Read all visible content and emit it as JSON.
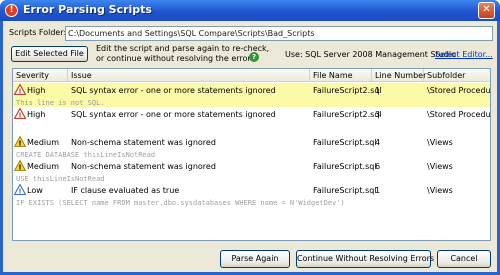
{
  "window": {
    "title": "Error Parsing Scripts",
    "close_glyph": "✕"
  },
  "folder": {
    "label": "Scripts Folder:",
    "value": "C:\\Documents and Settings\\SQL Compare\\Scripts\\Bad_Scripts"
  },
  "toolbar": {
    "edit_button": "Edit Selected File",
    "hint_line1": "Edit the script and parse again to re-check,",
    "hint_line2": "or continue without resolving the errors",
    "use_text": "Use: SQL Server 2008 Management Studio",
    "select_editor": "Select Editor..."
  },
  "columns": [
    "Severity",
    "Issue",
    "File Name",
    "Line Number",
    "Subfolder"
  ],
  "rows": [
    {
      "severity": "High",
      "icon": "error-icon",
      "issue": "SQL syntax error - one or more statements ignored",
      "file": "FailureScript2.sql",
      "line": "1",
      "subfolder": "\\Stored Procedures",
      "code": "This line is not SQL.",
      "selected": true
    },
    {
      "severity": "High",
      "icon": "error-icon",
      "issue": "SQL syntax error - one or more statements ignored",
      "file": "FailureScript2.sql",
      "line": "3",
      "subfolder": "\\Stored Procedures",
      "code": ""
    },
    {
      "severity": "Medium",
      "icon": "warning-icon",
      "issue": "Non-schema statement was ignored",
      "file": "FailureScript.sql",
      "line": "4",
      "subfolder": "\\Views",
      "code": "CREATE DATABASE thisLineIsNotRead"
    },
    {
      "severity": "Medium",
      "icon": "warning-icon",
      "issue": "Non-schema statement was ignored",
      "file": "FailureScript.sql",
      "line": "6",
      "subfolder": "\\Views",
      "code": "USE thisLineIsNotRead"
    },
    {
      "severity": "Low",
      "icon": "info-icon",
      "issue": "IF clause evaluated as true",
      "file": "FailureScript.sql",
      "line": "1",
      "subfolder": "\\Views",
      "code": "IF EXISTS (SELECT name FROM master.dbo.sysdatabases WHERE name = N'WidgetDev')"
    }
  ],
  "buttons": {
    "parse_again": "Parse Again",
    "continue": "Continue Without Resolving Errors",
    "cancel": "Cancel"
  },
  "colors": {
    "selected_row": "#fbfaa6",
    "link": "#0033cc",
    "title_bar": "#1f55d0"
  }
}
